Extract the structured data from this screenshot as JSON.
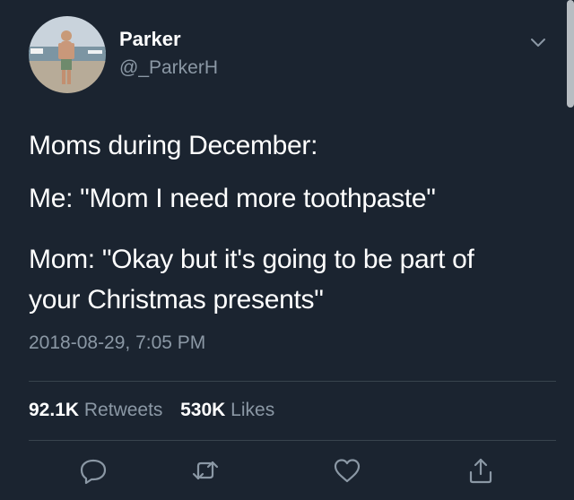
{
  "user": {
    "display_name": "Parker",
    "handle": "@_ParkerH"
  },
  "tweet": {
    "lines": [
      "Moms during December:",
      "Me: \"Mom I need more toothpaste\"",
      "Mom: \"Okay but it's going to be part of",
      "your Christmas presents\""
    ],
    "timestamp": "2018-08-29, 7:05 PM"
  },
  "stats": {
    "retweets_count": "92.1K",
    "retweets_label": "Retweets",
    "likes_count": "530K",
    "likes_label": "Likes"
  },
  "actions": [
    "reply-icon",
    "retweet-icon",
    "like-icon",
    "share-icon"
  ],
  "colors": {
    "background": "#1b2430",
    "secondary_text": "#8b98a5",
    "divider": "#38444d"
  }
}
